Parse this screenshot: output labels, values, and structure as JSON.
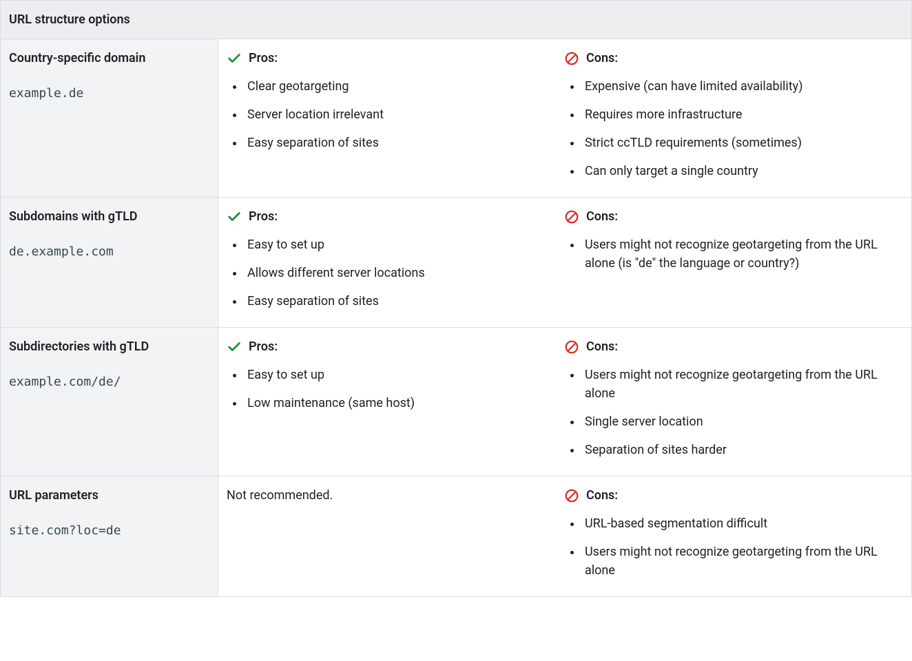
{
  "table": {
    "title": "URL structure options",
    "pros_label": "Pros:",
    "cons_label": "Cons:",
    "rows": [
      {
        "title": "Country-specific domain",
        "example": "example.de",
        "pros_type": "list",
        "pros": [
          "Clear geotargeting",
          "Server location irrelevant",
          "Easy separation of sites"
        ],
        "cons": [
          "Expensive (can have limited availability)",
          "Requires more infrastructure",
          "Strict ccTLD requirements (sometimes)",
          "Can only target a single country"
        ]
      },
      {
        "title": "Subdomains with gTLD",
        "example": "de.example.com",
        "pros_type": "list",
        "pros": [
          "Easy to set up",
          "Allows different server locations",
          "Easy separation of sites"
        ],
        "cons": [
          "Users might not recognize geotargeting from the URL alone (is \"de\" the language or country?)"
        ]
      },
      {
        "title": "Subdirectories with gTLD",
        "example": "example.com/de/",
        "pros_type": "list",
        "pros": [
          "Easy to set up",
          "Low maintenance (same host)"
        ],
        "cons": [
          "Users might not recognize geotargeting from the URL alone",
          "Single server location",
          "Separation of sites harder"
        ]
      },
      {
        "title": "URL parameters",
        "example": "site.com?loc=de",
        "pros_type": "text",
        "pros_text": "Not recommended.",
        "cons": [
          "URL-based segmentation difficult",
          "Users might not recognize geotargeting from the URL alone"
        ]
      }
    ]
  }
}
